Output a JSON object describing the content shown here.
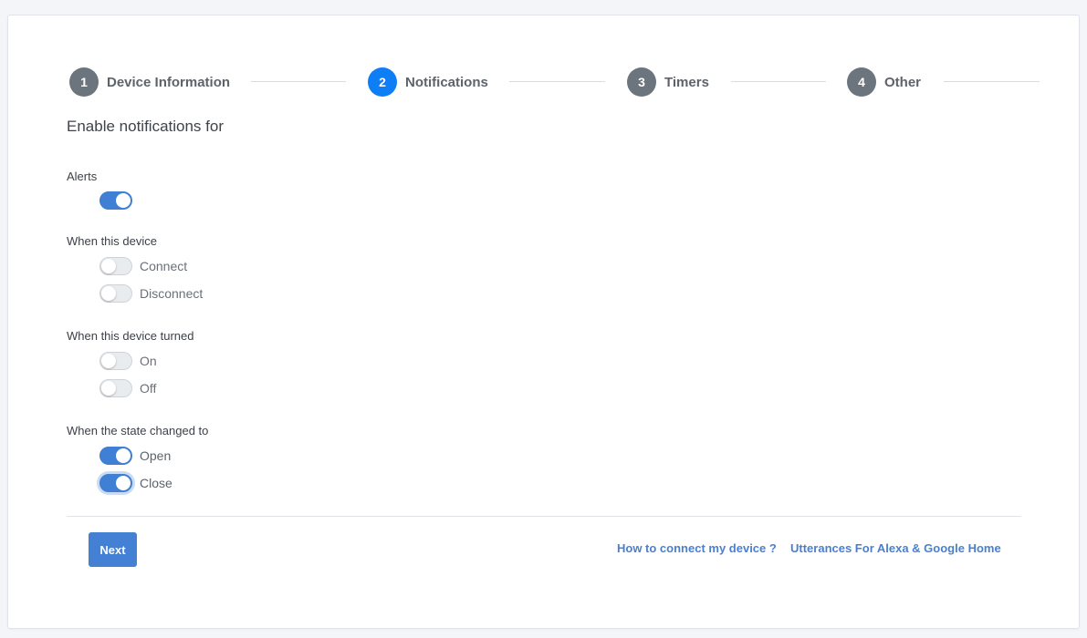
{
  "stepper": {
    "steps": [
      {
        "number": "1",
        "label": "Device Information",
        "active": false
      },
      {
        "number": "2",
        "label": "Notifications",
        "active": true
      },
      {
        "number": "3",
        "label": "Timers",
        "active": false
      },
      {
        "number": "4",
        "label": "Other",
        "active": false
      }
    ]
  },
  "form": {
    "title": "Enable notifications for",
    "alerts": {
      "label": "Alerts",
      "enabled": true
    },
    "connection": {
      "label": "When this device",
      "options": [
        {
          "label": "Connect",
          "enabled": false
        },
        {
          "label": "Disconnect",
          "enabled": false
        }
      ]
    },
    "power": {
      "label": "When this device turned",
      "options": [
        {
          "label": "On",
          "enabled": false
        },
        {
          "label": "Off",
          "enabled": false
        }
      ]
    },
    "state": {
      "label": "When the state changed to",
      "options": [
        {
          "label": "Open",
          "enabled": true
        },
        {
          "label": "Close",
          "enabled": true,
          "focused": true
        }
      ]
    }
  },
  "footer": {
    "next_label": "Next",
    "links": [
      {
        "label": "How to connect my device ?"
      },
      {
        "label": "Utterances For Alexa & Google Home"
      }
    ]
  },
  "colors": {
    "accent": "#4480d3",
    "active_step": "#0d7ef5",
    "inactive_step": "#6c757d",
    "link": "#4a7fd0"
  }
}
